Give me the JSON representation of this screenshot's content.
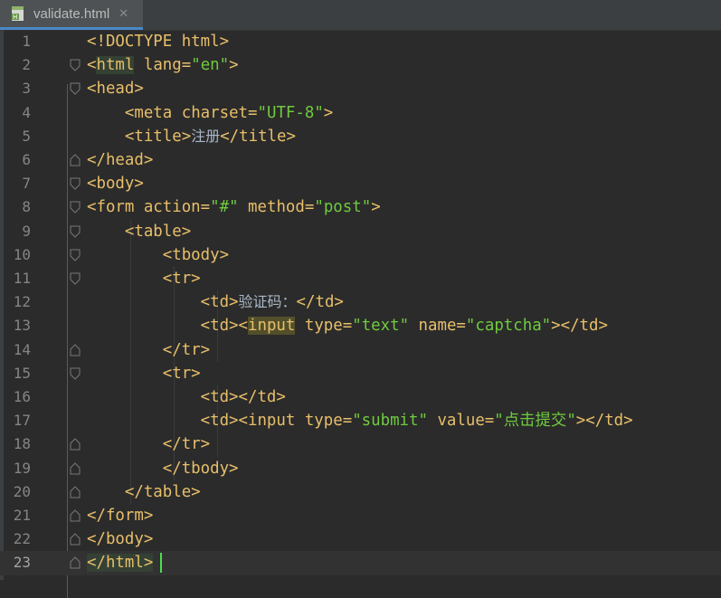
{
  "tab": {
    "file_name": "validate.html",
    "close_glyph": "✕",
    "icon": "html-file-icon"
  },
  "colors": {
    "background": "#2b2b2b",
    "tag": "#e8bf6a",
    "attr": "#e8bf6a",
    "string": "#6fcb3e",
    "text": "#a9b7c6",
    "caret": "#4be04b"
  },
  "current_line": 23,
  "lines": [
    {
      "n": "1",
      "indent": "",
      "parts": [
        [
          "t",
          "<!DOCTYPE "
        ],
        [
          "kw",
          "html"
        ],
        [
          "t",
          ">"
        ]
      ]
    },
    {
      "n": "2",
      "indent": "",
      "parts": [
        [
          "t",
          "<"
        ],
        [
          "t",
          "html"
        ],
        [
          "t",
          " "
        ],
        [
          "t",
          "lang"
        ],
        [
          "t",
          "="
        ],
        [
          "s",
          "\"en\""
        ],
        [
          "t",
          ">"
        ]
      ]
    },
    {
      "n": "3",
      "indent": "",
      "parts": [
        [
          "t",
          "<head>"
        ]
      ]
    },
    {
      "n": "4",
      "indent": "    ",
      "parts": [
        [
          "t",
          "<meta "
        ],
        [
          "t",
          "charset"
        ],
        [
          "t",
          "="
        ],
        [
          "s",
          "\"UTF-8\""
        ],
        [
          "t",
          ">"
        ]
      ]
    },
    {
      "n": "5",
      "indent": "    ",
      "parts": [
        [
          "t",
          "<title>"
        ],
        [
          "cjk",
          "注册"
        ],
        [
          "t",
          "</title>"
        ]
      ]
    },
    {
      "n": "6",
      "indent": "",
      "parts": [
        [
          "t",
          "</head>"
        ]
      ]
    },
    {
      "n": "7",
      "indent": "",
      "parts": [
        [
          "t",
          "<body>"
        ]
      ]
    },
    {
      "n": "8",
      "indent": "",
      "parts": [
        [
          "t",
          "<form "
        ],
        [
          "t",
          "action"
        ],
        [
          "t",
          "="
        ],
        [
          "s",
          "\"#\""
        ],
        [
          "t",
          " "
        ],
        [
          "t",
          "method"
        ],
        [
          "t",
          "="
        ],
        [
          "s",
          "\"post\""
        ],
        [
          "t",
          ">"
        ]
      ]
    },
    {
      "n": "9",
      "indent": "    ",
      "parts": [
        [
          "t",
          "<table>"
        ]
      ]
    },
    {
      "n": "10",
      "indent": "        ",
      "parts": [
        [
          "t",
          "<tbody>"
        ]
      ]
    },
    {
      "n": "11",
      "indent": "        ",
      "parts": [
        [
          "t",
          "<tr>"
        ]
      ]
    },
    {
      "n": "12",
      "indent": "            ",
      "parts": [
        [
          "t",
          "<td>"
        ],
        [
          "cjk",
          "验证码："
        ],
        [
          "t",
          "</td>"
        ]
      ]
    },
    {
      "n": "13",
      "indent": "            ",
      "parts": [
        [
          "t",
          "<td><"
        ],
        [
          "t",
          "input"
        ],
        [
          "t",
          " "
        ],
        [
          "t",
          "type"
        ],
        [
          "t",
          "="
        ],
        [
          "s",
          "\"text\""
        ],
        [
          "t",
          " "
        ],
        [
          "t",
          "name"
        ],
        [
          "t",
          "="
        ],
        [
          "s",
          "\"captcha\""
        ],
        [
          "t",
          "></td>"
        ]
      ]
    },
    {
      "n": "14",
      "indent": "        ",
      "parts": [
        [
          "t",
          "</tr>"
        ]
      ]
    },
    {
      "n": "15",
      "indent": "        ",
      "parts": [
        [
          "t",
          "<tr>"
        ]
      ]
    },
    {
      "n": "16",
      "indent": "            ",
      "parts": [
        [
          "t",
          "<td></td>"
        ]
      ]
    },
    {
      "n": "17",
      "indent": "            ",
      "parts": [
        [
          "t",
          "<td><input "
        ],
        [
          "t",
          "type"
        ],
        [
          "t",
          "="
        ],
        [
          "s",
          "\"submit\""
        ],
        [
          "t",
          " "
        ],
        [
          "t",
          "value"
        ],
        [
          "t",
          "="
        ],
        [
          "s",
          "\"点击提交\""
        ],
        [
          "t",
          "></td>"
        ]
      ]
    },
    {
      "n": "18",
      "indent": "        ",
      "parts": [
        [
          "t",
          "</tr>"
        ]
      ]
    },
    {
      "n": "19",
      "indent": "        ",
      "parts": [
        [
          "t",
          "</tbody>"
        ]
      ]
    },
    {
      "n": "20",
      "indent": "    ",
      "parts": [
        [
          "t",
          "</table>"
        ]
      ]
    },
    {
      "n": "21",
      "indent": "",
      "parts": [
        [
          "t",
          "</form>"
        ]
      ]
    },
    {
      "n": "22",
      "indent": "",
      "parts": [
        [
          "t",
          "</body>"
        ]
      ]
    },
    {
      "n": "23",
      "indent": "",
      "parts": [
        [
          "t",
          "</html>"
        ]
      ]
    }
  ],
  "fold_markers": {
    "open": [
      2,
      3,
      7,
      8,
      9,
      10,
      11,
      15
    ],
    "close": [
      6,
      14,
      18,
      19,
      20,
      21,
      22,
      23
    ]
  }
}
